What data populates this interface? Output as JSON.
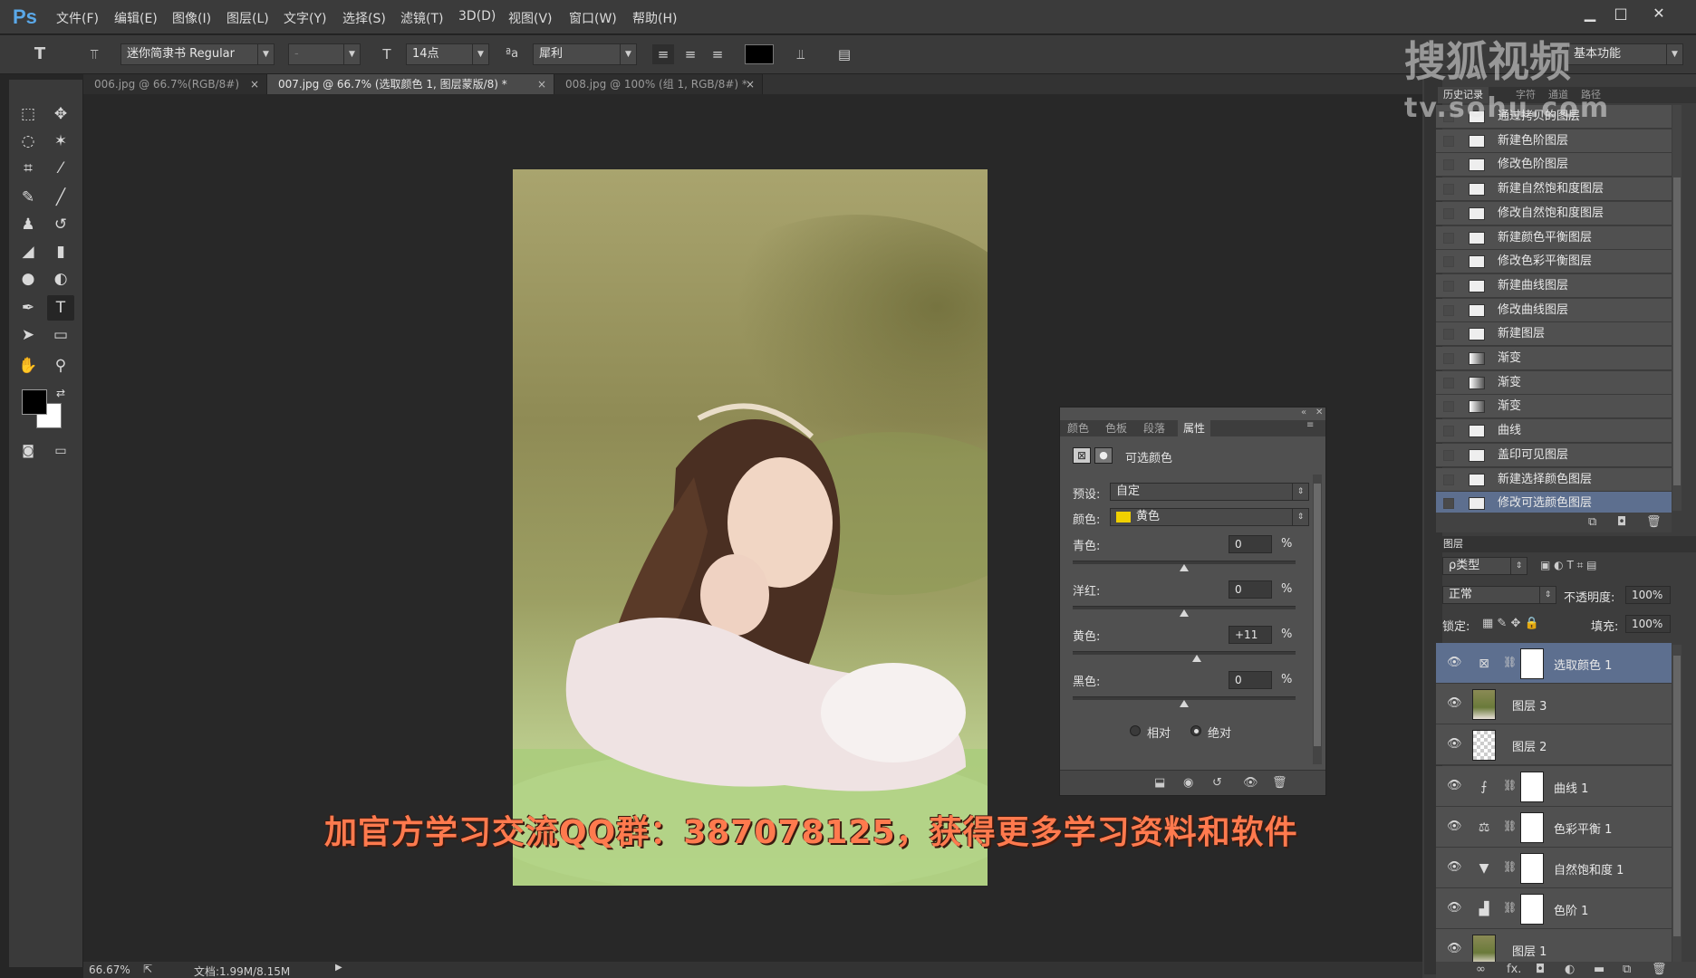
{
  "app": {
    "logo": "Ps"
  },
  "menu": [
    "文件(F)",
    "编辑(E)",
    "图像(I)",
    "图层(L)",
    "文字(Y)",
    "选择(S)",
    "滤镜(T)",
    "3D(D)",
    "视图(V)",
    "窗口(W)",
    "帮助(H)"
  ],
  "window_controls": {
    "minimize": "▁",
    "restore": "□",
    "close": "✕"
  },
  "options": {
    "tool_glyph": "T",
    "font_family": "迷你简隶书 Regular",
    "font_style": "-",
    "font_size": "14点",
    "aa_label": "ªa",
    "antialias": "犀利",
    "text_color": "#000000",
    "workspace": "基本功能"
  },
  "tabs": [
    {
      "label": "006.jpg @ 66.7%(RGB/8#)"
    },
    {
      "label": "007.jpg @ 66.7% (选取颜色 1, 图层蒙版/8) *"
    },
    {
      "label": "008.jpg @ 100% (组 1, RGB/8#) *"
    }
  ],
  "tab_close": "×",
  "status": {
    "zoom": "66.67%",
    "doc": "文档:1.99M/8.15M"
  },
  "properties": {
    "tabs": [
      "颜色",
      "色板",
      "段落",
      "属性"
    ],
    "title": "可选颜色",
    "preset_label": "预设:",
    "preset_value": "自定",
    "colors_label": "颜色:",
    "colors_value": "黄色",
    "colors_swatch": "#f0d000",
    "sliders": [
      {
        "label": "青色:",
        "value": "0",
        "pct": 0.5
      },
      {
        "label": "洋红:",
        "value": "0",
        "pct": 0.5
      },
      {
        "label": "黄色:",
        "value": "+11",
        "pct": 0.555
      },
      {
        "label": "黑色:",
        "value": "0",
        "pct": 0.5
      }
    ],
    "percent": "%",
    "method_relative": "相对",
    "method_absolute": "绝对"
  },
  "history": {
    "tabs": [
      "历史记录",
      "字符",
      "通道",
      "路径"
    ],
    "items": [
      {
        "label": "通过拷贝的图层",
        "icon": "doc"
      },
      {
        "label": "新建色阶图层",
        "icon": "doc"
      },
      {
        "label": "修改色阶图层",
        "icon": "doc"
      },
      {
        "label": "新建自然饱和度图层",
        "icon": "doc"
      },
      {
        "label": "修改自然饱和度图层",
        "icon": "doc"
      },
      {
        "label": "新建颜色平衡图层",
        "icon": "doc"
      },
      {
        "label": "修改色彩平衡图层",
        "icon": "doc"
      },
      {
        "label": "新建曲线图层",
        "icon": "doc"
      },
      {
        "label": "修改曲线图层",
        "icon": "doc"
      },
      {
        "label": "新建图层",
        "icon": "doc"
      },
      {
        "label": "渐变",
        "icon": "grad"
      },
      {
        "label": "渐变",
        "icon": "grad"
      },
      {
        "label": "渐变",
        "icon": "grad"
      },
      {
        "label": "曲线",
        "icon": "doc"
      },
      {
        "label": "盖印可见图层",
        "icon": "doc"
      },
      {
        "label": "新建选择颜色图层",
        "icon": "doc"
      },
      {
        "label": "修改可选颜色图层",
        "icon": "doc",
        "selected": true
      }
    ]
  },
  "layers": {
    "title": "图层",
    "filter": "ρ类型",
    "blend": "正常",
    "opacity_label": "不透明度:",
    "opacity": "100%",
    "lock_label": "锁定:",
    "fill_label": "填充:",
    "fill": "100%",
    "items": [
      {
        "name": "选取颜色 1",
        "type": "adjust",
        "glyph": "⊠",
        "selected": true
      },
      {
        "name": "图层 3",
        "type": "photo"
      },
      {
        "name": "图层 2",
        "type": "checker"
      },
      {
        "name": "曲线 1",
        "type": "adjust",
        "glyph": "⨍"
      },
      {
        "name": "色彩平衡 1",
        "type": "adjust",
        "glyph": "⚖"
      },
      {
        "name": "自然饱和度 1",
        "type": "adjust",
        "glyph": "▼"
      },
      {
        "name": "色阶 1",
        "type": "adjust",
        "glyph": "▟"
      },
      {
        "name": "图层 1",
        "type": "photo"
      }
    ]
  },
  "subtitle": "加官方学习交流QQ群：387078125，获得更多学习资料和软件",
  "watermark": {
    "line1": "搜狐视频",
    "line2": "tv.sohu.com"
  }
}
